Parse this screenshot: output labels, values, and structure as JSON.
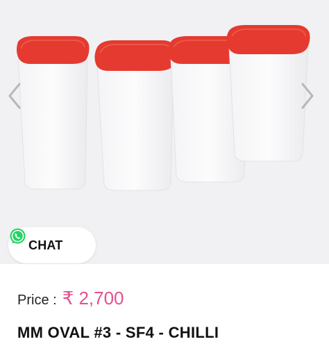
{
  "gallery": {
    "image_description": "Four oval plastic storage containers with red lids",
    "prev_icon": "chevron-left-icon",
    "next_icon": "chevron-right-icon"
  },
  "chat": {
    "label": "CHAT",
    "icon": "whatsapp-icon",
    "icon_color": "#25d366"
  },
  "price": {
    "label": "Price :",
    "value": "₹ 2,700",
    "color": "#e64f8d"
  },
  "product": {
    "title": "MM OVAL #3 - SF4 - CHILLI"
  }
}
